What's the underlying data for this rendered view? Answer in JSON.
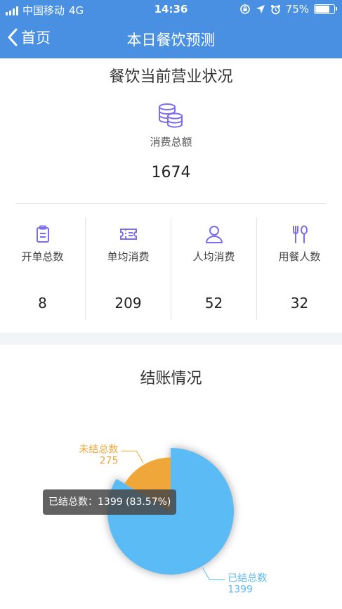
{
  "status_bar": {
    "carrier": "中国移动",
    "network": "4G",
    "time": "14:36",
    "battery": "75%",
    "battery_level": 0.75
  },
  "nav": {
    "back_label": "首页",
    "title": "本日餐饮预测"
  },
  "overview": {
    "title": "餐饮当前营业状况",
    "total_label": "消费总额",
    "total_value": "1674",
    "stats": [
      {
        "label": "开单总数",
        "value": "8",
        "icon": "clipboard-icon"
      },
      {
        "label": "单均消费",
        "value": "209",
        "icon": "ticket-icon"
      },
      {
        "label": "人均消费",
        "value": "52",
        "icon": "person-icon"
      },
      {
        "label": "用餐人数",
        "value": "32",
        "icon": "fork-spoon-icon"
      }
    ]
  },
  "checkout": {
    "title": "结账情况",
    "tooltip": "已结总数：1399 (83.57%)"
  },
  "colors": {
    "brand": "#4a90e2",
    "icon_purple": "#7b6cf0",
    "settled": "#5bbcf5",
    "unsettled": "#f0a73a"
  },
  "chart_data": {
    "type": "pie",
    "title": "结账情况",
    "slices": [
      {
        "label": "已结总数",
        "value": 1399,
        "percent": 83.57,
        "color": "#5bbcf5"
      },
      {
        "label": "未结总数",
        "value": 275,
        "color": "#f0a73a"
      }
    ]
  }
}
